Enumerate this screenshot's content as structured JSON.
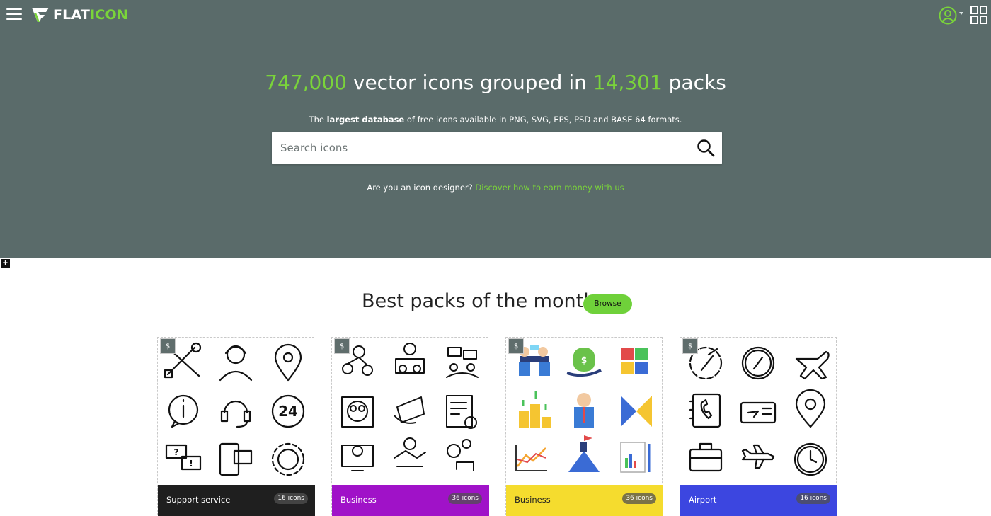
{
  "header": {
    "logo_text_main": "FLAT",
    "logo_text_accent": "ICON",
    "menu_icon": "hamburger-menu-icon",
    "user_icon": "user-account-icon",
    "apps_icon": "apps-grid-icon"
  },
  "hero": {
    "count_icons": "747,000",
    "text_middle": " vector icons grouped in ",
    "count_packs": "14,301",
    "text_end": " packs",
    "sub_prefix": "The ",
    "sub_bold": "largest database",
    "sub_suffix": " of free icons available in PNG, SVG, EPS, PSD and BASE 64 formats.",
    "search_placeholder": "Search icons",
    "designer_question": "Are you an icon designer? ",
    "designer_link": "Discover how to earn money with us"
  },
  "section": {
    "title": "Best packs of the month",
    "browse_label": "Browse"
  },
  "packs": [
    {
      "name": "Support service",
      "count": "16 icons",
      "color": "#1f1f1f",
      "premium": "$"
    },
    {
      "name": "Business",
      "count": "36 icons",
      "color": "#a012c8",
      "premium": "$"
    },
    {
      "name": "Business",
      "count": "36 icons",
      "color": "#f5dc2e",
      "premium": "$"
    },
    {
      "name": "Airport",
      "count": "16 icons",
      "color": "#3c46e0",
      "premium": "$"
    }
  ],
  "colors": {
    "hero_bg": "#5a6b6a",
    "accent": "#7ad43a",
    "browse_bg": "#6fd13a"
  }
}
